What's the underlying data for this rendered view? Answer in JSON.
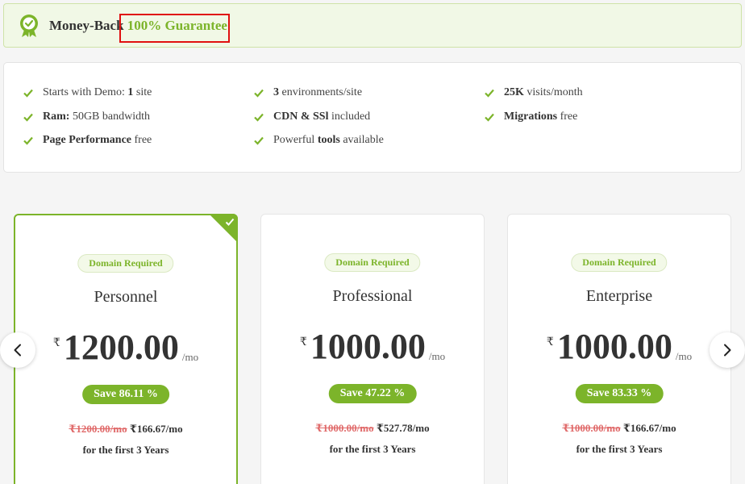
{
  "banner": {
    "text_prefix": "Money-Back",
    "text_highlight": "100% Guarantee",
    "icon": "guarantee-badge-icon"
  },
  "features": [
    {
      "bold": "",
      "pre": "Starts with Demo: ",
      "mid": "1",
      "post": " site"
    },
    {
      "bold": "3",
      "pre": "",
      "mid": "",
      "post": " environments/site"
    },
    {
      "bold": "25K",
      "pre": "",
      "mid": "",
      "post": " visits/month"
    },
    {
      "bold": "Ram:",
      "pre": "",
      "mid": "",
      "post": " 50GB bandwidth"
    },
    {
      "bold": "CDN & SSl",
      "pre": "",
      "mid": "",
      "post": " included"
    },
    {
      "bold": "Migrations",
      "pre": "",
      "mid": "",
      "post": " free"
    },
    {
      "bold": "Page Performance",
      "pre": "",
      "mid": "",
      "post": " free"
    },
    {
      "bold": "",
      "pre": "Powerful ",
      "mid": "tools",
      "post": " available"
    }
  ],
  "plans": [
    {
      "badge": "Domain Required",
      "name": "Personnel",
      "currency": "₹",
      "price": "1200.00",
      "period": "/mo",
      "save": "Save 86.11 %",
      "old_price": "₹1200.00/mo",
      "new_price": "₹166.67/mo",
      "term": "for the first 3 Years",
      "selected": true
    },
    {
      "badge": "Domain Required",
      "name": "Professional",
      "currency": "₹",
      "price": "1000.00",
      "period": "/mo",
      "save": "Save 47.22 %",
      "old_price": "₹1000.00/mo",
      "new_price": "₹527.78/mo",
      "term": "for the first 3 Years",
      "selected": false
    },
    {
      "badge": "Domain Required",
      "name": "Enterprise",
      "currency": "₹",
      "price": "1000.00",
      "period": "/mo",
      "save": "Save 83.33 %",
      "old_price": "₹1000.00/mo",
      "new_price": "₹166.67/mo",
      "term": "for the first 3 Years",
      "selected": false
    }
  ],
  "carousel": {
    "prev_icon": "chevron-left-icon",
    "next_icon": "chevron-right-icon"
  },
  "colors": {
    "accent": "#7cb42a",
    "strike": "#e06a6a",
    "highlight_box": "#e01010"
  }
}
